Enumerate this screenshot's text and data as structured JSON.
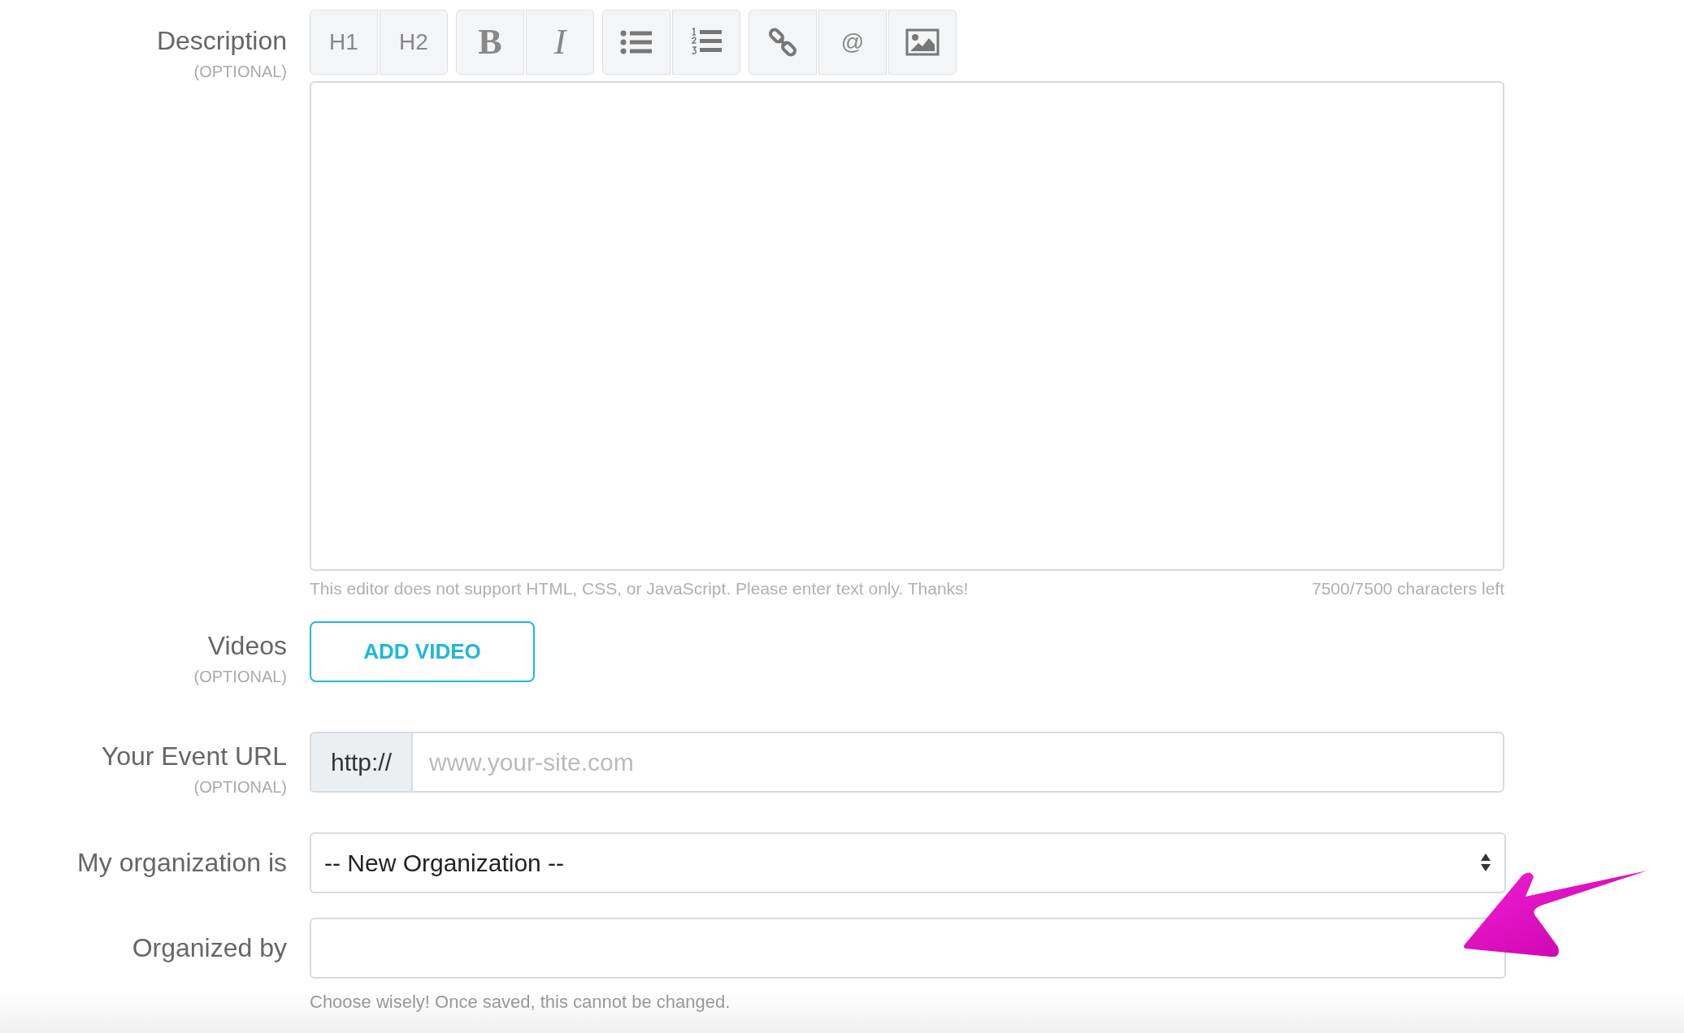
{
  "description": {
    "label": "Description",
    "optional": "(OPTIONAL)",
    "toolbar": [
      [
        {
          "kind": "text",
          "label": "H1"
        },
        {
          "kind": "text",
          "label": "H2"
        }
      ],
      [
        {
          "kind": "bold",
          "label": "B"
        },
        {
          "kind": "italic",
          "label": "I"
        }
      ],
      [
        {
          "kind": "bullets"
        },
        {
          "kind": "numbers"
        }
      ],
      [
        {
          "kind": "link"
        },
        {
          "kind": "text",
          "label": "@"
        },
        {
          "kind": "image"
        }
      ]
    ],
    "help": "This editor does not support HTML, CSS, or JavaScript. Please enter text only. Thanks!",
    "counter": "7500/7500 characters left"
  },
  "videos": {
    "label": "Videos",
    "optional": "(OPTIONAL)",
    "button": "ADD VIDEO"
  },
  "event_url": {
    "label": "Your Event URL",
    "optional": "(OPTIONAL)",
    "prefix": "http://",
    "placeholder": "www.your-site.com"
  },
  "organization": {
    "label": "My organization is",
    "value": "-- New Organization --"
  },
  "organized_by": {
    "label": "Organized by",
    "hint": "Choose wisely! Once saved, this cannot be changed."
  }
}
